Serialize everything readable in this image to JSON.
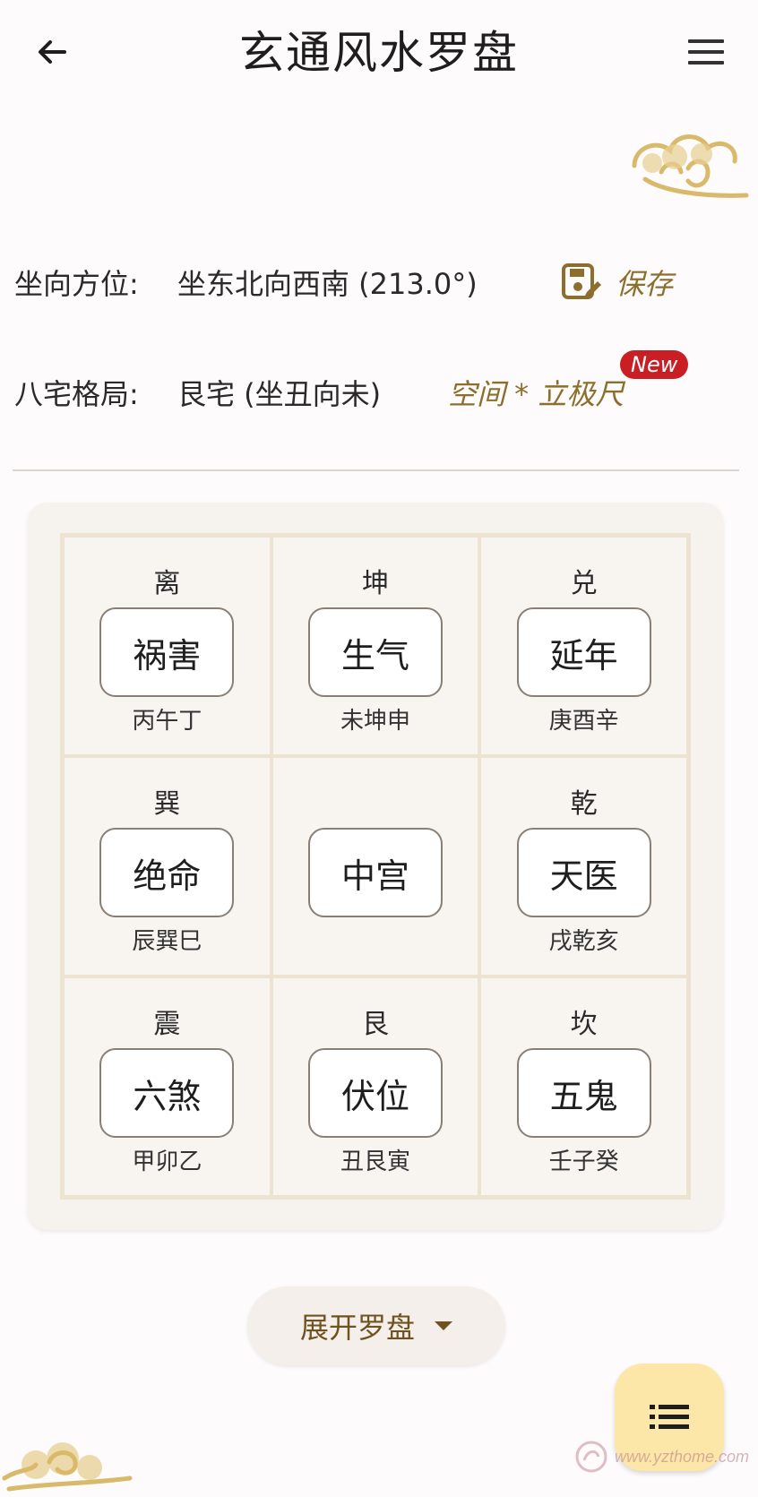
{
  "header": {
    "title": "玄通风水罗盘",
    "back_icon": "arrow-left-icon",
    "menu_icon": "hamburger-menu-icon"
  },
  "info": {
    "facing_label": "坐向方位:",
    "facing_value": "坐东北向西南 (213.0°)",
    "save_label": "保存",
    "save_icon": "save-edit-icon",
    "house_label": "八宅格局:",
    "house_value": "艮宅 (坐丑向未)",
    "taiji_link": "空间 * 立极尺",
    "new_badge": "New"
  },
  "grid": {
    "cells": [
      {
        "trigram": "离",
        "star": "祸害",
        "mountains": "丙午丁"
      },
      {
        "trigram": "坤",
        "star": "生气",
        "mountains": "未坤申"
      },
      {
        "trigram": "兑",
        "star": "延年",
        "mountains": "庚酉辛"
      },
      {
        "trigram": "巽",
        "star": "绝命",
        "mountains": "辰巽巳"
      },
      {
        "trigram": "",
        "star": "中宫",
        "mountains": ""
      },
      {
        "trigram": "乾",
        "star": "天医",
        "mountains": "戌乾亥"
      },
      {
        "trigram": "震",
        "star": "六煞",
        "mountains": "甲卯乙"
      },
      {
        "trigram": "艮",
        "star": "伏位",
        "mountains": "丑艮寅"
      },
      {
        "trigram": "坎",
        "star": "五鬼",
        "mountains": "壬子癸"
      }
    ]
  },
  "expand": {
    "label": "展开罗盘",
    "icon": "caret-down-icon"
  },
  "fab": {
    "icon": "list-icon"
  },
  "watermark": {
    "text": "www.yzthome.com"
  },
  "colors": {
    "accent_gold": "#8c6f2c",
    "badge_red": "#c91f24",
    "fab_bg": "#fde7a8",
    "grid_line": "#ece3d1"
  }
}
